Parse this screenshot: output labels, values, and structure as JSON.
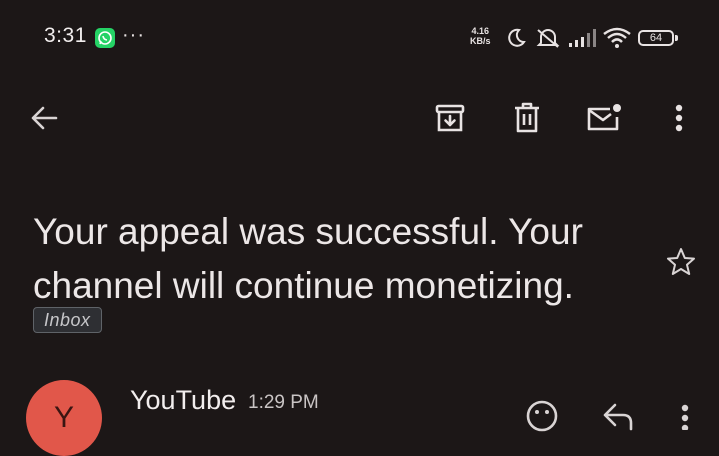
{
  "status_bar": {
    "time": "3:31",
    "notification_dots": "···",
    "net_speed_value": "4.16",
    "net_speed_unit": "KB/s",
    "battery": "64"
  },
  "toolbar": {
    "back_icon": "arrow-left-icon",
    "archive_icon": "archive-icon",
    "delete_icon": "trash-icon",
    "mark_unread_icon": "mail-unread-icon",
    "more_icon": "more-vert-icon"
  },
  "email": {
    "subject": "Your appeal was successful. Your channel will continue monetizing.",
    "label": "Inbox",
    "sender": "YouTube",
    "time": "1:29 PM",
    "avatar_letter": "Y"
  },
  "colors": {
    "background": "#1c1717",
    "avatar": "#e1574a",
    "whatsapp": "#25d366"
  }
}
